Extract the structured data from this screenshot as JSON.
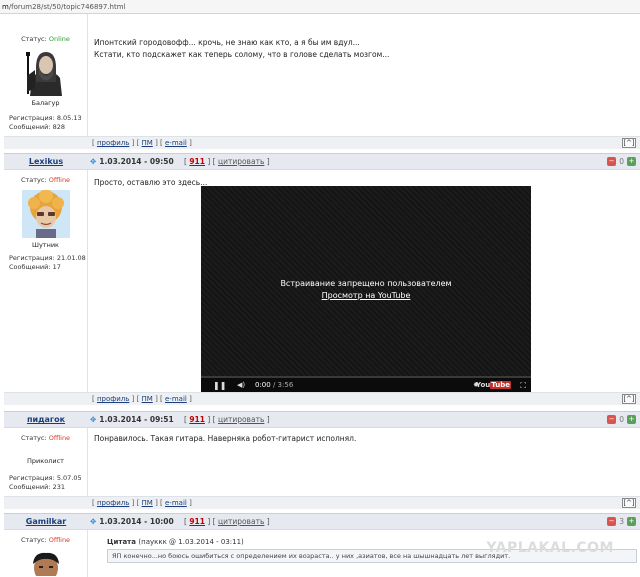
{
  "address_bar": {
    "host": "m",
    "path": "/forum28/st/50/topic746897.html"
  },
  "posts": [
    {
      "user": {
        "status_label": "Статус:",
        "status_value": "Online",
        "rank": "Балагур",
        "registration": "Регистрация: 8.05.13",
        "messages": "Сообщений: 828"
      },
      "text_lines": [
        "Ипонтский городовофф... крочь, не знаю как кто, а я бы им вдул...",
        "Кстати, кто подскажет как теперь солому, что в голове сделать мозгом..."
      ],
      "footer": {
        "profile": "профиль",
        "pm": "ПМ",
        "email": "e-mail",
        "up": "[^]"
      }
    },
    {
      "user": {
        "nick": "Lexikus",
        "status_label": "Статус:",
        "status_value": "Offline",
        "rank": "Шутник",
        "registration": "Регистрация: 21.01.08",
        "messages": "Сообщений: 17"
      },
      "date": "1.03.2014 - 09:50",
      "post_number": "911",
      "quote_label": "цитировать",
      "rating": "0",
      "text_lines": [
        "Просто, оставлю это здесь..."
      ],
      "video": {
        "message": "Встраивание запрещено пользователем",
        "link": "Просмотр на YouTube",
        "time_current": "0:00",
        "time_total": "/ 3:56",
        "brand_you": "You",
        "brand_tube": "Tube"
      },
      "footer": {
        "profile": "профиль",
        "pm": "ПМ",
        "email": "e-mail",
        "up": "[^]"
      }
    },
    {
      "user": {
        "nick": "пидагок",
        "status_label": "Статус:",
        "status_value": "Offline",
        "rank": "Приколист",
        "registration": "Регистрация: 5.07.05",
        "messages": "Сообщений: 231"
      },
      "date": "1.03.2014 - 09:51",
      "post_number": "911",
      "quote_label": "цитировать",
      "rating": "0",
      "text_lines": [
        "Понравилось. Такая гитара. Наверняка робот-гитарист исполнял."
      ],
      "footer": {
        "profile": "профиль",
        "pm": "ПМ",
        "email": "e-mail",
        "up": "[^]"
      }
    },
    {
      "user": {
        "nick": "Gamilkar",
        "status_label": "Статус:",
        "status_value": "Offline"
      },
      "date": "1.03.2014 - 10:00",
      "post_number": "911",
      "quote_label": "цитировать",
      "rating": "3",
      "quote": {
        "title": "Цитата",
        "source": "(пауккк @ 1.03.2014 - 03:11)",
        "text": "ЯП конечно...но боюсь ошибиться с определением их возраста.. у них ,азиатов, все на шышнадцать лет выглядит."
      }
    }
  ],
  "watermark": "YAPLAKAL.COM",
  "colors": {
    "online": "#2ea02e",
    "offline": "#d43a2a",
    "nick": "#1a3f7a",
    "header_bg": "#e6e9ef",
    "post_number": "#c00000"
  }
}
